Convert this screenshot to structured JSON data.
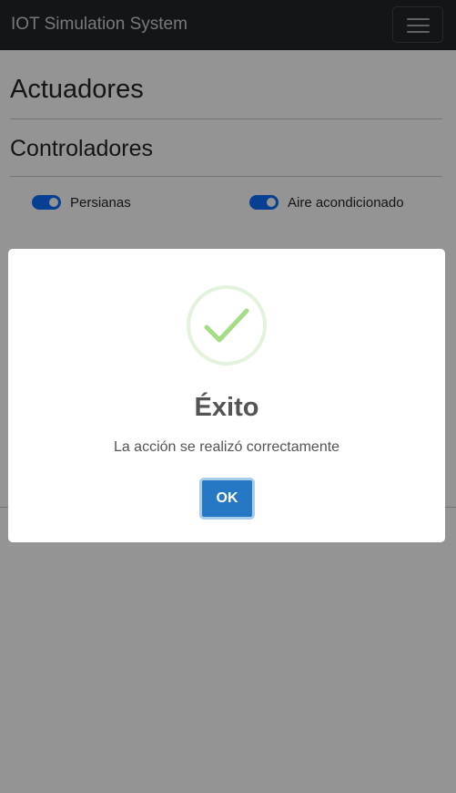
{
  "navbar": {
    "brand": "IOT Simulation System",
    "menu_icon": "hamburger-menu-icon"
  },
  "main": {
    "section_title": "Actuadores",
    "subsection_title": "Controladores",
    "controllers": [
      {
        "label": "Persianas",
        "checked": true
      },
      {
        "label": "Aire acondicionado",
        "checked": true
      }
    ]
  },
  "modal": {
    "icon": "success-check-icon",
    "title": "Éxito",
    "message": "La acción se realizó correctamente",
    "ok_label": "OK"
  },
  "colors": {
    "navbar_bg": "#212529",
    "switch_on": "#0d6efd",
    "success_icon": "#a5dc86",
    "confirm_button": "#2778c4"
  }
}
